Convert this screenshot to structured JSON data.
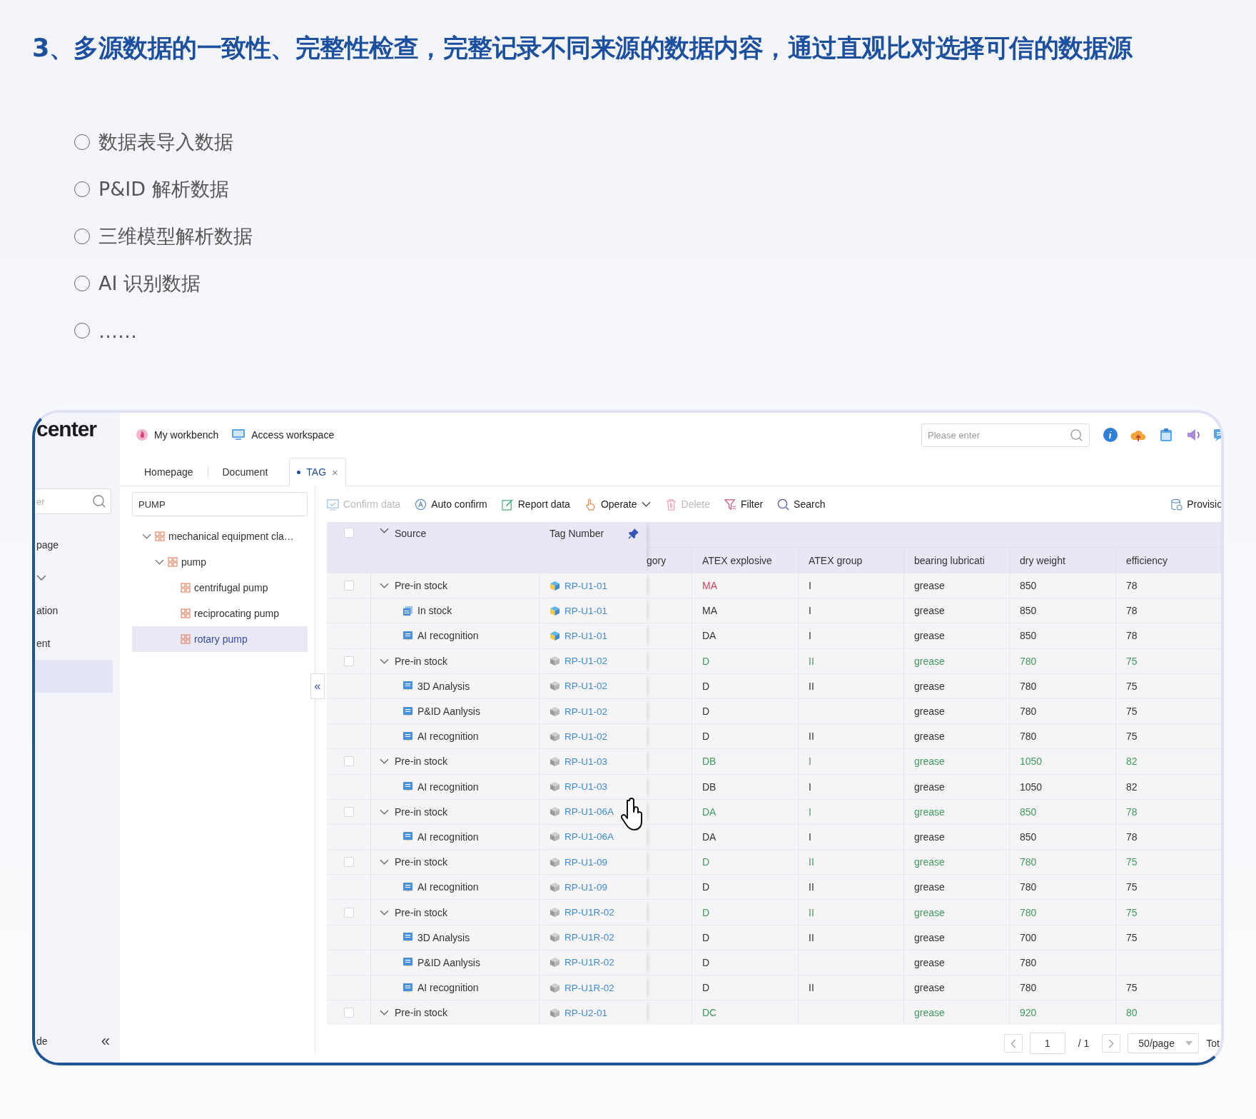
{
  "heading": "3、多源数据的一致性、完整性检查，完整记录不同来源的数据内容，通过直观比对选择可信的数据源",
  "options": [
    {
      "label": "数据表导入数据",
      "selected": false
    },
    {
      "label": "P&ID 解析数据",
      "selected": false
    },
    {
      "label": "三维模型解析数据",
      "selected": false
    },
    {
      "label": "AI 识别数据",
      "selected": false
    },
    {
      "label": "……",
      "selected": false
    }
  ],
  "app": {
    "logo": "center",
    "sidebar": {
      "search_placeholder": "er",
      "items": [
        {
          "kind": "link",
          "label": "page",
          "selected": false
        },
        {
          "kind": "group",
          "expanded": false,
          "selected": false
        },
        {
          "kind": "link",
          "label": "ation",
          "selected": false
        },
        {
          "kind": "link",
          "label": "ent",
          "selected": false
        },
        {
          "kind": "link",
          "selected": true
        }
      ],
      "footer_label": "de",
      "collapse_glyph": "«"
    },
    "header": {
      "links": [
        {
          "label": "My workbench",
          "kind": "workbench"
        },
        {
          "label": "Access workspace",
          "kind": "workspace"
        }
      ],
      "search_placeholder": "Please enter"
    },
    "tabs": [
      {
        "label": "Homepage",
        "selected": false
      },
      {
        "label": "Document",
        "selected": false
      },
      {
        "label": "TAG",
        "selected": true,
        "close_glyph": "×"
      }
    ],
    "tree": {
      "search_value": "PUMP",
      "collapse_glyph": "«",
      "nodes": [
        {
          "label": "mechanical equipment cla…",
          "expanded": true,
          "selected": false,
          "children": [
            {
              "label": "pump",
              "expanded": true,
              "selected": false,
              "children": [
                {
                  "label": "centrifugal pump",
                  "selected": false
                },
                {
                  "label": "reciprocating pump",
                  "selected": false
                },
                {
                  "label": "rotary pump",
                  "selected": true
                }
              ]
            }
          ]
        }
      ]
    },
    "toolbar": [
      {
        "kind": "confirm",
        "label": "Confirm data",
        "disabled": true
      },
      {
        "kind": "auto",
        "label": "Auto confirm",
        "disabled": false
      },
      {
        "kind": "report",
        "label": "Report data",
        "disabled": false
      },
      {
        "kind": "operate",
        "label": "Operate",
        "disabled": false
      },
      {
        "kind": "delete",
        "label": "Delete",
        "disabled": true
      },
      {
        "kind": "filter",
        "label": "Filter",
        "disabled": false
      },
      {
        "kind": "search",
        "label": "Search",
        "disabled": false
      },
      {
        "kind": "provision",
        "label": "Provisio",
        "disabled": false
      }
    ],
    "table": {
      "all_checked": false,
      "fixed_columns": [
        "Source",
        "Tag Number"
      ],
      "columns": [
        "gory",
        "ATEX explosive",
        "ATEX group",
        "bearing lubricati",
        "dry weight",
        "efficiency"
      ],
      "groups": [
        {
          "source": "Pre-in stock",
          "tag": "RP-U1-01",
          "tag_highlighted": true,
          "checked": false,
          "expanded": true,
          "cells": {
            "atex_explosive": {
              "text": "MA",
              "color": "#d2405a"
            },
            "atex_group": "I",
            "lubrication": "grease",
            "dry_weight": "850",
            "efficiency": "78"
          },
          "children": [
            {
              "kind": "stock",
              "source": "In stock",
              "tag": "RP-U1-01",
              "tag_highlighted": true,
              "cells": {
                "atex_explosive": "MA",
                "atex_group": "I",
                "lubrication": "grease",
                "dry_weight": "850",
                "efficiency": "78"
              }
            },
            {
              "kind": "analysis",
              "source": "AI recognition",
              "tag": "RP-U1-01",
              "tag_highlighted": true,
              "cells": {
                "atex_explosive": "DA",
                "atex_group": "I",
                "lubrication": "grease",
                "dry_weight": "850",
                "efficiency": "78"
              }
            }
          ]
        },
        {
          "source": "Pre-in stock",
          "tag": "RP-U1-02",
          "tag_highlighted": false,
          "checked": false,
          "expanded": true,
          "color": "#3c9d5d",
          "cells": {
            "atex_explosive": "D",
            "atex_group": "II",
            "lubrication": "grease",
            "dry_weight": "780",
            "efficiency": "75"
          },
          "children": [
            {
              "kind": "analysis",
              "source": "3D Analysis",
              "tag": "RP-U1-02",
              "tag_highlighted": false,
              "cells": {
                "atex_explosive": "D",
                "atex_group": "II",
                "lubrication": "grease",
                "dry_weight": "780",
                "efficiency": "75"
              }
            },
            {
              "kind": "analysis",
              "source": "P&ID Aanlysis",
              "tag": "RP-U1-02",
              "tag_highlighted": false,
              "cells": {
                "atex_explosive": "D",
                "lubrication": "grease",
                "dry_weight": "780",
                "efficiency": "75"
              }
            },
            {
              "kind": "analysis",
              "source": "AI recognition",
              "tag": "RP-U1-02",
              "tag_highlighted": false,
              "cells": {
                "atex_explosive": "D",
                "atex_group": "II",
                "lubrication": "grease",
                "dry_weight": "780",
                "efficiency": "75"
              }
            }
          ]
        },
        {
          "source": "Pre-in stock",
          "tag": "RP-U1-03",
          "tag_highlighted": false,
          "checked": false,
          "expanded": true,
          "color": "#3c9d5d",
          "cells": {
            "atex_explosive": "DB",
            "atex_group": "I",
            "lubrication": "grease",
            "dry_weight": "1050",
            "efficiency": "82"
          },
          "children": [
            {
              "kind": "analysis",
              "source": "AI recognition",
              "tag": "RP-U1-03",
              "tag_highlighted": false,
              "cells": {
                "atex_explosive": "DB",
                "atex_group": "I",
                "lubrication": "grease",
                "dry_weight": "1050",
                "efficiency": "82"
              }
            }
          ]
        },
        {
          "source": "Pre-in stock",
          "tag": "RP-U1-06A",
          "tag_highlighted": false,
          "checked": false,
          "expanded": true,
          "color": "#3c9d5d",
          "cells": {
            "atex_explosive": "DA",
            "atex_group": "I",
            "lubrication": "grease",
            "dry_weight": "850",
            "efficiency": "78"
          },
          "children": [
            {
              "kind": "analysis",
              "source": "AI recognition",
              "tag": "RP-U1-06A",
              "tag_highlighted": false,
              "cells": {
                "atex_explosive": "DA",
                "atex_group": "I",
                "lubrication": "grease",
                "dry_weight": "850",
                "efficiency": "78"
              }
            }
          ]
        },
        {
          "source": "Pre-in stock",
          "tag": "RP-U1-09",
          "tag_highlighted": false,
          "checked": false,
          "expanded": true,
          "color": "#3c9d5d",
          "cells": {
            "atex_explosive": "D",
            "atex_group": "II",
            "lubrication": "grease",
            "dry_weight": "780",
            "efficiency": "75"
          },
          "children": [
            {
              "kind": "analysis",
              "source": "AI recognition",
              "tag": "RP-U1-09",
              "tag_highlighted": false,
              "cells": {
                "atex_explosive": "D",
                "atex_group": "II",
                "lubrication": "grease",
                "dry_weight": "780",
                "efficiency": "75"
              }
            }
          ]
        },
        {
          "source": "Pre-in stock",
          "tag": "RP-U1R-02",
          "tag_highlighted": false,
          "checked": false,
          "expanded": true,
          "color": "#3c9d5d",
          "cells": {
            "atex_explosive": "D",
            "atex_group": "II",
            "lubrication": "grease",
            "dry_weight": "780",
            "efficiency": "75"
          },
          "children": [
            {
              "kind": "analysis",
              "source": "3D Analysis",
              "tag": "RP-U1R-02",
              "tag_highlighted": false,
              "cells": {
                "atex_explosive": "D",
                "atex_group": "II",
                "lubrication": "grease",
                "dry_weight": "700",
                "efficiency": "75"
              }
            },
            {
              "kind": "analysis",
              "source": "P&ID Aanlysis",
              "tag": "RP-U1R-02",
              "tag_highlighted": false,
              "cells": {
                "atex_explosive": "D",
                "lubrication": "grease",
                "dry_weight": "780"
              }
            },
            {
              "kind": "analysis",
              "source": "AI recognition",
              "tag": "RP-U1R-02",
              "tag_highlighted": false,
              "cells": {
                "atex_explosive": "D",
                "atex_group": "II",
                "lubrication": "grease",
                "dry_weight": "780",
                "efficiency": "75"
              }
            }
          ]
        },
        {
          "source": "Pre-in stock",
          "tag": "RP-U2-01",
          "tag_highlighted": false,
          "checked": false,
          "expanded": true,
          "color": "#3c9d5d",
          "cells": {
            "atex_explosive": "DC",
            "lubrication": "grease",
            "dry_weight": "920",
            "efficiency": "80"
          }
        }
      ]
    },
    "pagination": {
      "page": "1",
      "total_pages": "/ 1",
      "page_size": "50/page",
      "total": "Tot"
    }
  }
}
